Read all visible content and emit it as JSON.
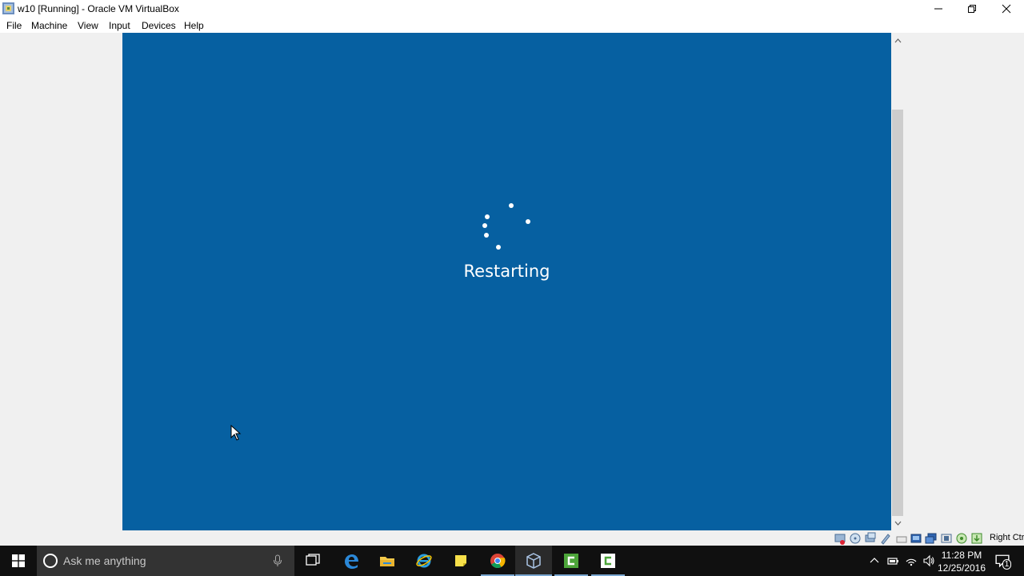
{
  "window": {
    "title": "w10 [Running] - Oracle VM VirtualBox",
    "icon": "virtualbox-app-icon"
  },
  "menu": {
    "items": [
      "File",
      "Machine",
      "View",
      "Input",
      "Devices",
      "Help"
    ]
  },
  "guest": {
    "background_color": "#0660a1",
    "status_text": "Restarting"
  },
  "statusbar": {
    "icons": [
      "hard-disk-icon",
      "optical-drive-icon",
      "audio-icon",
      "network-icon",
      "usb-icon",
      "shared-folders-icon",
      "display-icon",
      "video-capture-icon",
      "cpu-activity-icon",
      "mouse-integration-icon",
      "keyboard-capture-icon"
    ],
    "host_key": "Right Ctrl"
  },
  "taskbar": {
    "search_placeholder": "Ask me anything",
    "apps": [
      "task-view-icon",
      "edge-icon",
      "file-explorer-icon",
      "internet-explorer-icon",
      "sticky-notes-icon",
      "chrome-icon",
      "virtualbox-icon",
      "camtasia-recorder-icon",
      "camtasia-studio-icon"
    ],
    "clock": {
      "time": "11:28 PM",
      "date": "12/25/2016"
    },
    "notification_count": "1"
  }
}
